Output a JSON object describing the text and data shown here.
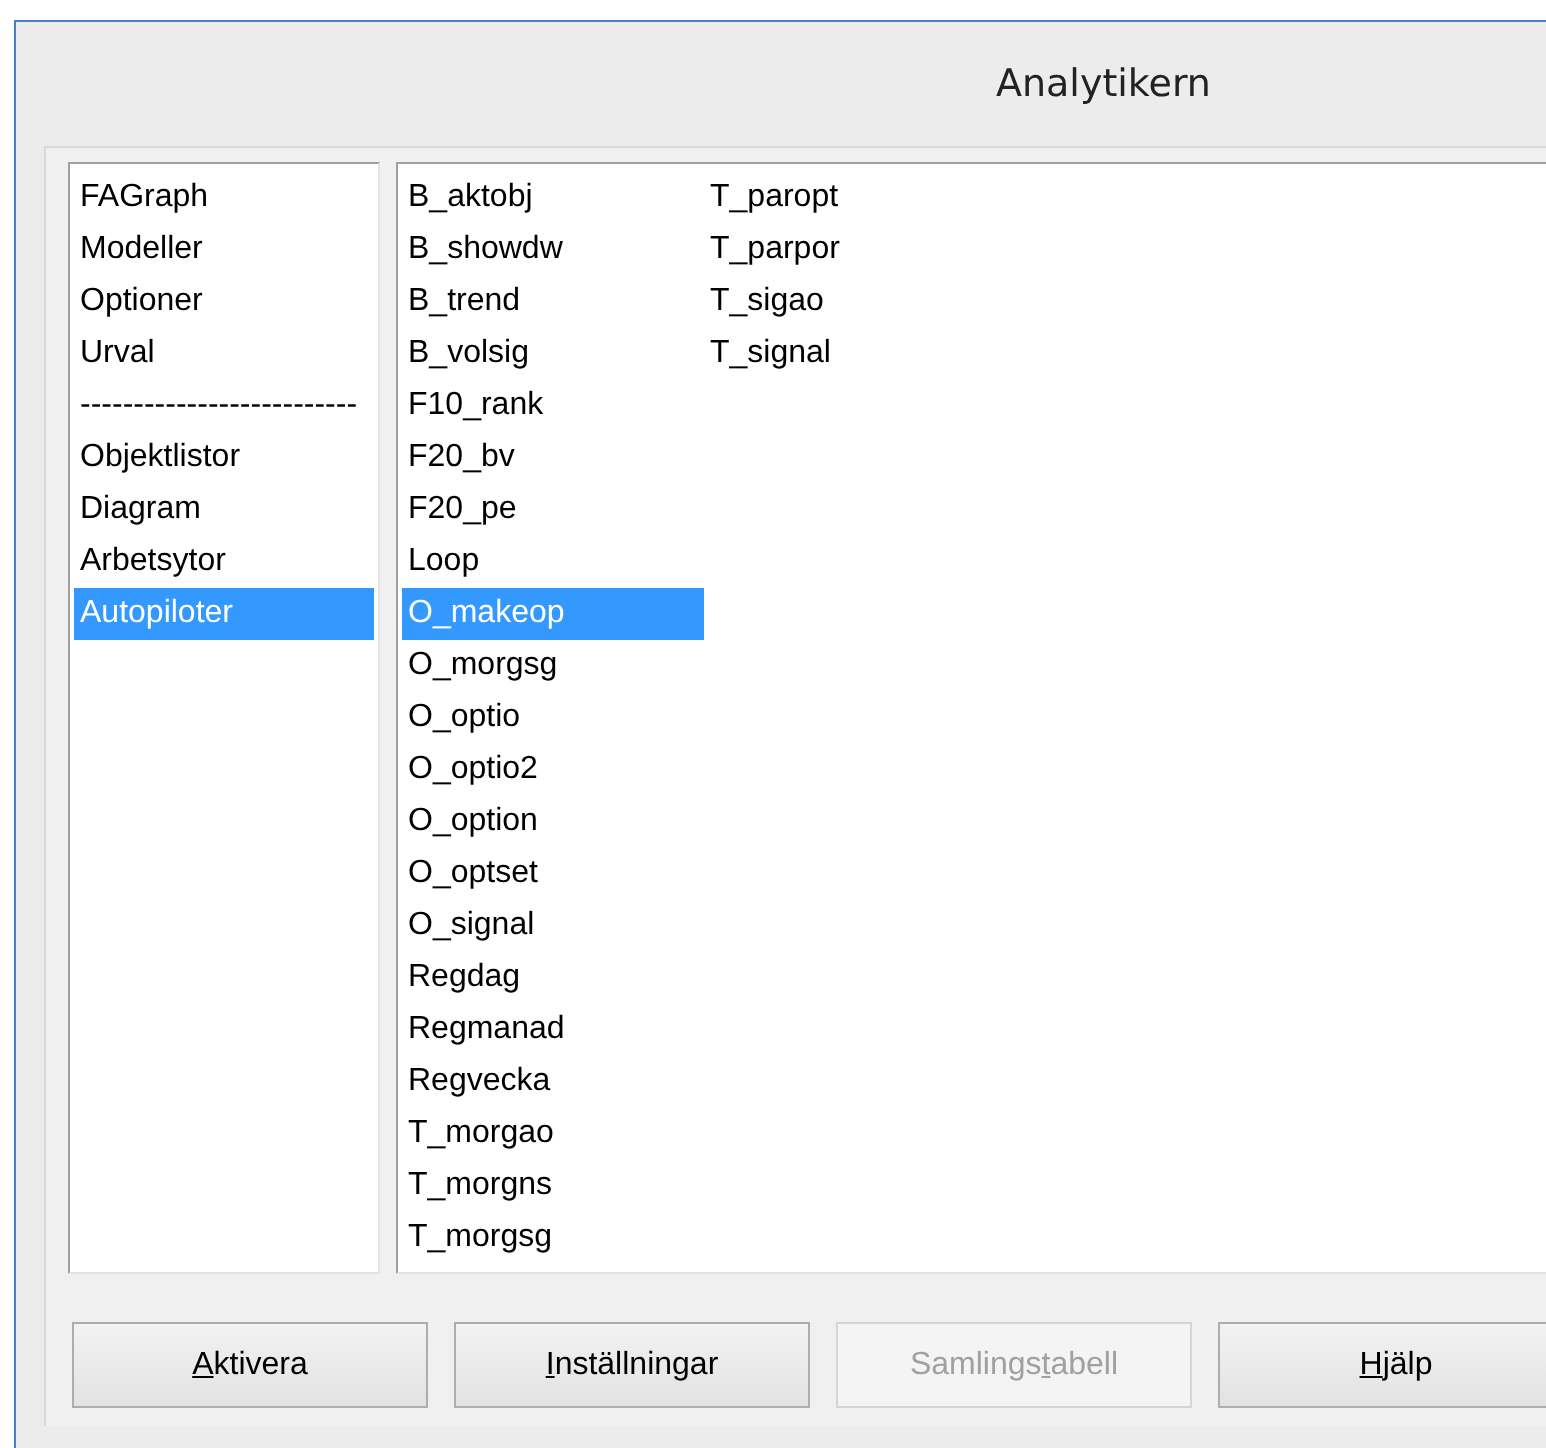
{
  "window": {
    "title": "Analytikern"
  },
  "categories": [
    {
      "label": "FAGraph",
      "selected": false
    },
    {
      "label": "Modeller",
      "selected": false
    },
    {
      "label": "Optioner",
      "selected": false
    },
    {
      "label": "Urval",
      "selected": false
    },
    {
      "label": "--------------------------",
      "selected": false
    },
    {
      "label": "Objektlistor",
      "selected": false
    },
    {
      "label": "Diagram",
      "selected": false
    },
    {
      "label": "Arbetsytor",
      "selected": false
    },
    {
      "label": "Autopiloter",
      "selected": true
    }
  ],
  "items": [
    {
      "label": "B_aktobj",
      "selected": false
    },
    {
      "label": "B_showdw",
      "selected": false
    },
    {
      "label": "B_trend",
      "selected": false
    },
    {
      "label": "B_volsig",
      "selected": false
    },
    {
      "label": "F10_rank",
      "selected": false
    },
    {
      "label": "F20_bv",
      "selected": false
    },
    {
      "label": "F20_pe",
      "selected": false
    },
    {
      "label": "Loop",
      "selected": false
    },
    {
      "label": "O_makeop",
      "selected": true
    },
    {
      "label": "O_morgsg",
      "selected": false
    },
    {
      "label": "O_optio",
      "selected": false
    },
    {
      "label": "O_optio2",
      "selected": false
    },
    {
      "label": "O_option",
      "selected": false
    },
    {
      "label": "O_optset",
      "selected": false
    },
    {
      "label": "O_signal",
      "selected": false
    },
    {
      "label": "Regdag",
      "selected": false
    },
    {
      "label": "Regmanad",
      "selected": false
    },
    {
      "label": "Regvecka",
      "selected": false
    },
    {
      "label": "T_morgao",
      "selected": false
    },
    {
      "label": "T_morgns",
      "selected": false
    },
    {
      "label": "T_morgsg",
      "selected": false
    },
    {
      "label": "T_paropt",
      "selected": false
    },
    {
      "label": "T_parpor",
      "selected": false
    },
    {
      "label": "T_sigao",
      "selected": false
    },
    {
      "label": "T_signal",
      "selected": false
    }
  ],
  "buttons": [
    {
      "access_key": "A",
      "after": "ktivera",
      "disabled": false
    },
    {
      "access_key": "I",
      "after": "nställningar",
      "disabled": false
    },
    {
      "before": "Samlings",
      "access_key": "t",
      "after": "abell",
      "disabled": true
    },
    {
      "access_key": "H",
      "after": "jälp",
      "disabled": false
    }
  ]
}
